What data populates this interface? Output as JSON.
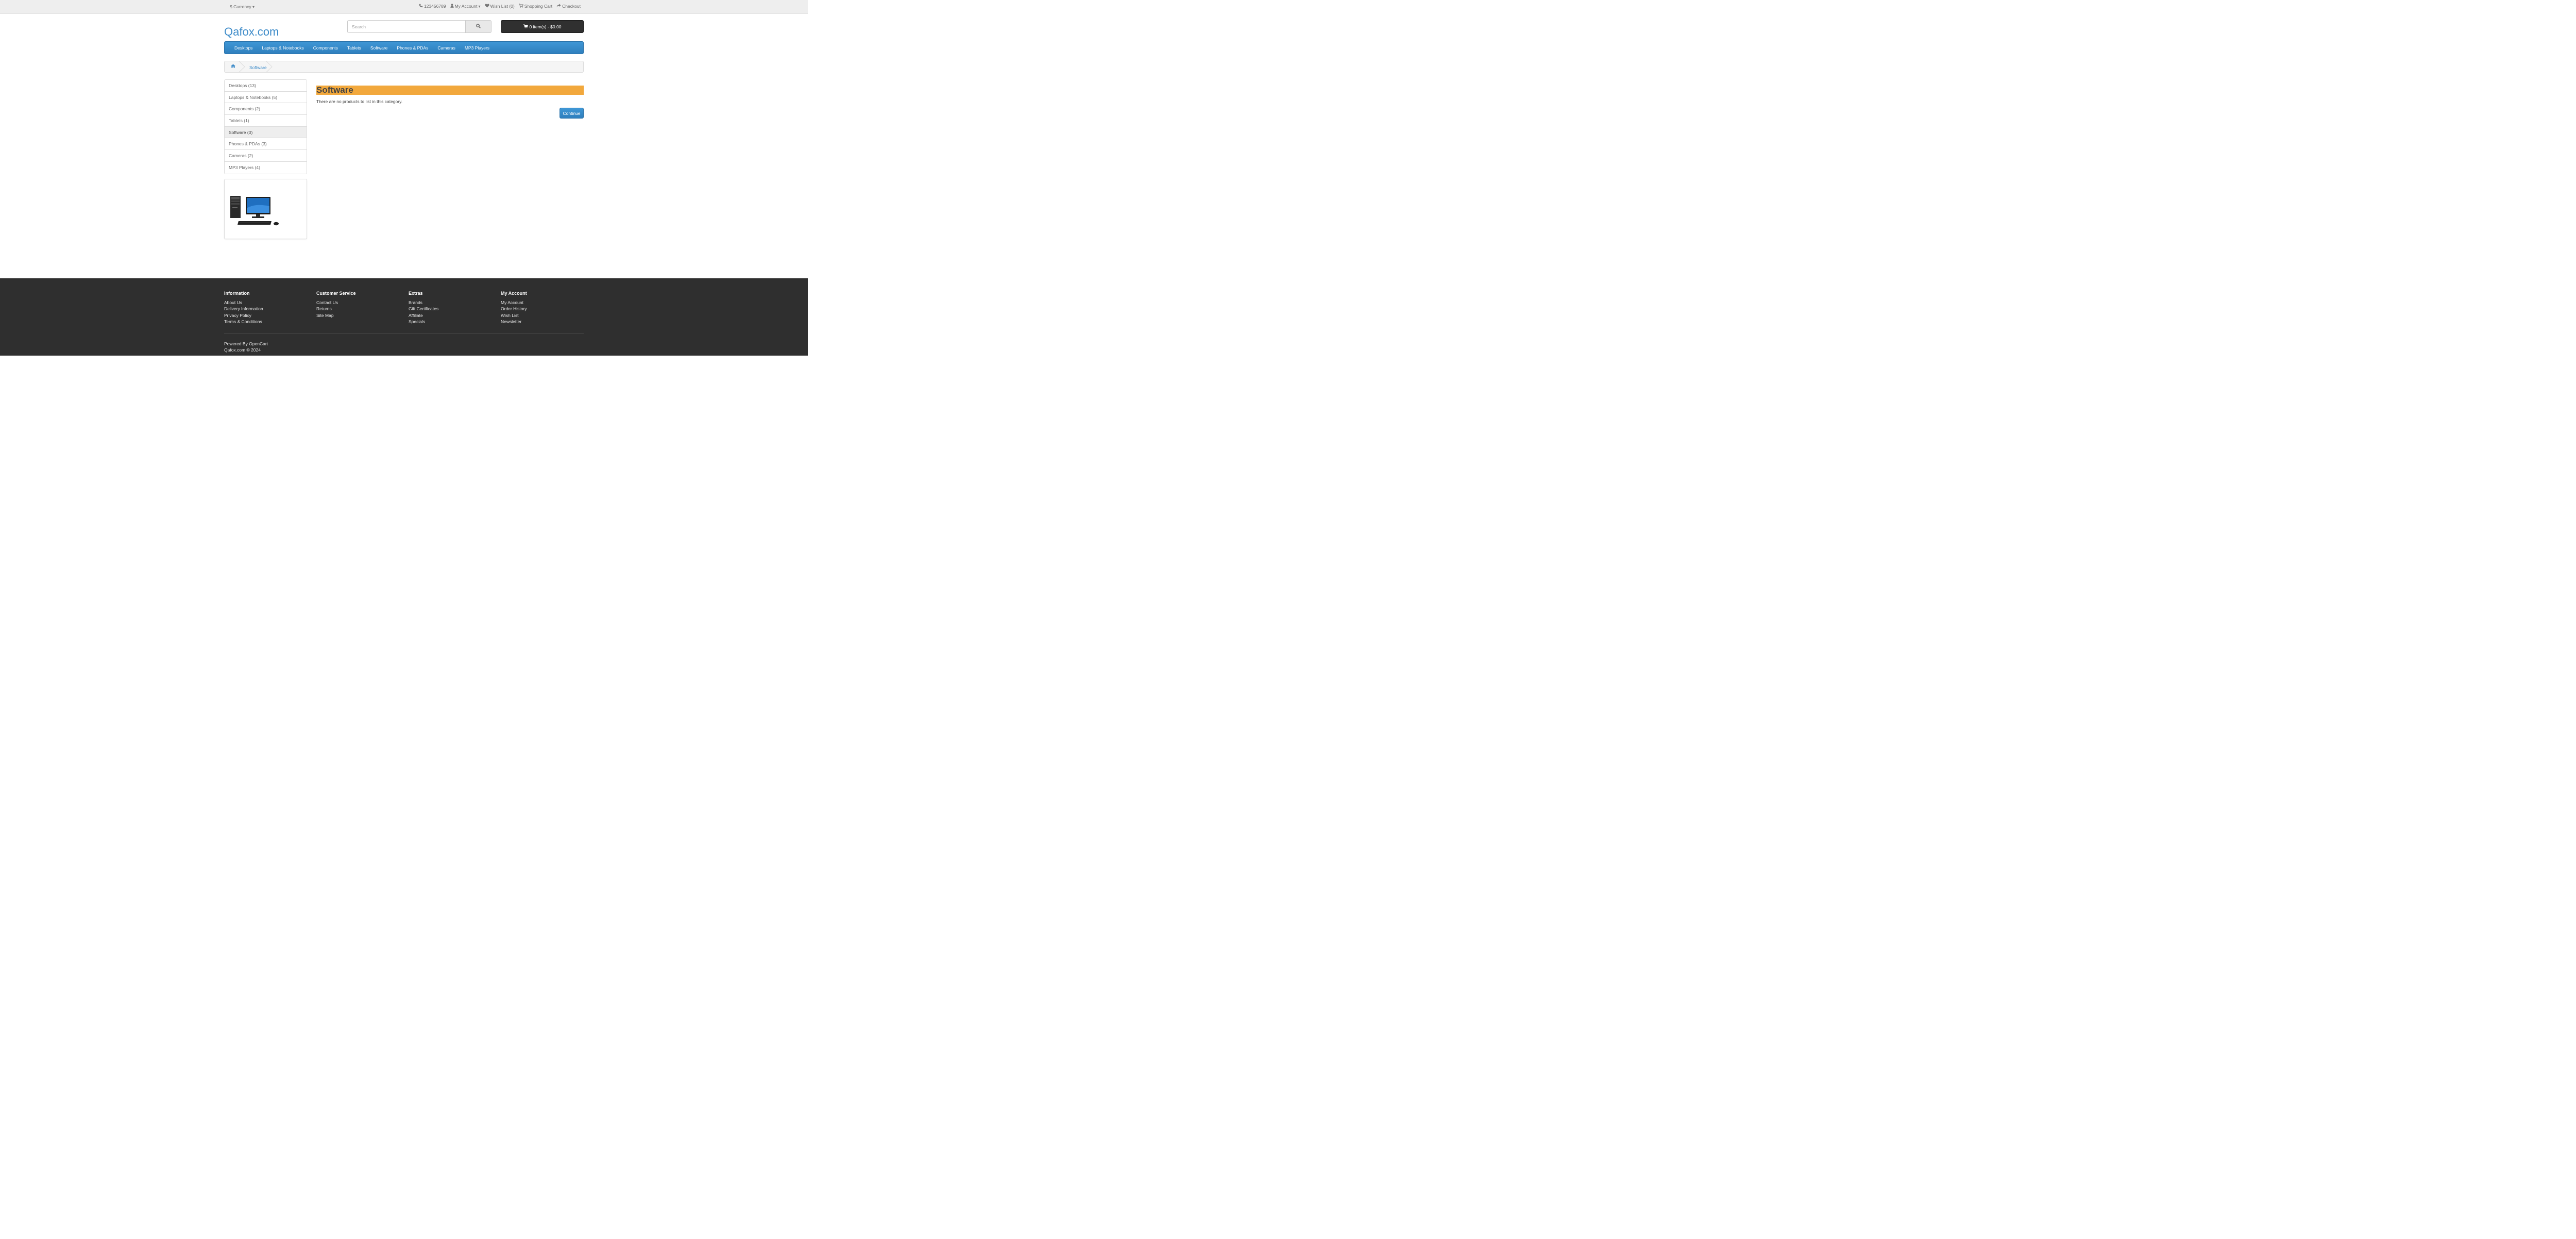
{
  "topbar": {
    "currency_label": "$ Currency",
    "phone": "123456789",
    "my_account": "My Account",
    "wishlist": "Wish List (0)",
    "cart": "Shopping Cart",
    "checkout": "Checkout"
  },
  "header": {
    "logo": "Qafox.com",
    "search_placeholder": "Search",
    "cart_button": "0 item(s) - $0.00"
  },
  "nav": {
    "items": [
      "Desktops",
      "Laptops & Notebooks",
      "Components",
      "Tablets",
      "Software",
      "Phones & PDAs",
      "Cameras",
      "MP3 Players"
    ]
  },
  "breadcrumb": {
    "current": "Software"
  },
  "sidebar": {
    "categories": [
      {
        "label": "Desktops (13)",
        "active": false
      },
      {
        "label": "Laptops & Notebooks (5)",
        "active": false
      },
      {
        "label": "Components (2)",
        "active": false
      },
      {
        "label": "Tablets (1)",
        "active": false
      },
      {
        "label": "Software (0)",
        "active": true
      },
      {
        "label": "Phones & PDAs (3)",
        "active": false
      },
      {
        "label": "Cameras (2)",
        "active": false
      },
      {
        "label": "MP3 Players (4)",
        "active": false
      }
    ]
  },
  "main": {
    "heading": "Software",
    "empty_text": "There are no products to list in this category.",
    "continue_label": "Continue"
  },
  "footer": {
    "columns": [
      {
        "title": "Information",
        "links": [
          "About Us",
          "Delivery Information",
          "Privacy Policy",
          "Terms & Conditions"
        ]
      },
      {
        "title": "Customer Service",
        "links": [
          "Contact Us",
          "Returns",
          "Site Map"
        ]
      },
      {
        "title": "Extras",
        "links": [
          "Brands",
          "Gift Certificates",
          "Affiliate",
          "Specials"
        ]
      },
      {
        "title": "My Account",
        "links": [
          "My Account",
          "Order History",
          "Wish List",
          "Newsletter"
        ]
      }
    ],
    "powered_prefix": "Powered By ",
    "powered_link": "OpenCart",
    "copyright": "Qafox.com © 2024"
  },
  "colors": {
    "accent": "#3d8bc9",
    "nav_bg": "#3a8fcd",
    "heading_highlight": "#f2a83c",
    "footer_bg": "#2f2f2f",
    "cart_button_bg": "#303030"
  },
  "icons": {
    "phone": "phone-icon",
    "account": "user-icon",
    "wishlist": "heart-icon",
    "cart": "shopping-cart-icon",
    "checkout": "share-icon",
    "search": "search-icon",
    "home": "home-icon",
    "caret": "caret-down-icon"
  }
}
